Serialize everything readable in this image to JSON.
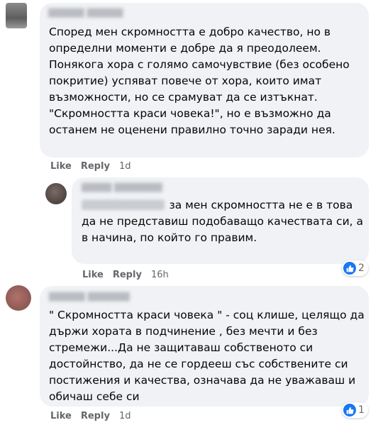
{
  "comments": [
    {
      "text": "Според мен скромността е добро качество, но в определни моменти е добре да я преодолеем. Понякога хора с голямо самочувствие (без особено покритие) успяват повече от хора, които имат възможности, но се срамуват да се изтъкнат. \"Скромността краси човека!\", но е възможно да останем не оценени правилно точно заради нея.",
      "like": "Like",
      "reply": "Reply",
      "time": "1d"
    },
    {
      "text": "за мен скромността не е в това да не представиш подобаващо качествата си, а в начина, по който го правим.",
      "like": "Like",
      "reply": "Reply",
      "time": "16h",
      "reaction_count": "2"
    },
    {
      "text": "\" Скромността краси човека \" - соц клише, целящо да държи хората в подчинение , без мечти и без стремежи...Да не защитаваш собственото си достойнство, да не се гордееш със собствените си постижения и качества, означава да не уважаваш и обичаш себе си",
      "like": "Like",
      "reply": "Reply",
      "time": "1d",
      "reaction_count": "1"
    }
  ],
  "colors": {
    "bubble": "#f0f2f5",
    "like_blue": "#1877f2",
    "meta_gray": "#65676b"
  }
}
